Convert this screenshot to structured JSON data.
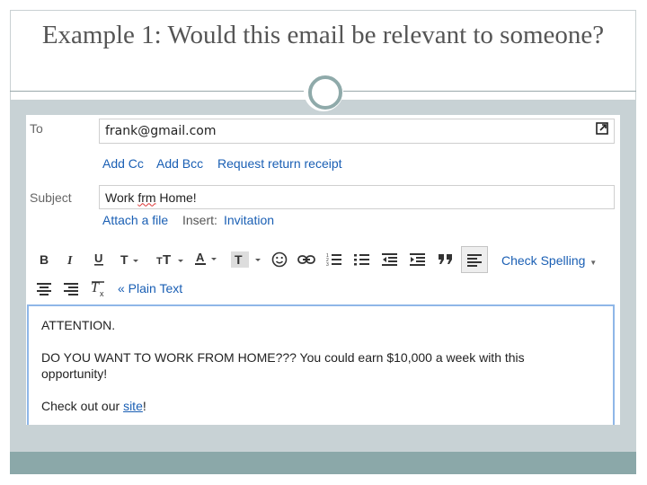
{
  "slide": {
    "title": "Example 1: Would this email be relevant to someone?"
  },
  "compose": {
    "to_label": "To",
    "to_value": "frank@gmail.com",
    "add_cc": "Add Cc",
    "add_bcc": "Add Bcc",
    "request_receipt": "Request return receipt",
    "subject_label": "Subject",
    "subject_misspelled": "frm",
    "subject_prefix": "Work ",
    "subject_suffix": " Home!",
    "attach_file": "Attach a file",
    "insert_label": "Insert:",
    "invitation": "Invitation",
    "check_spelling": "Check Spelling",
    "plain_text": "« Plain Text"
  },
  "toolbar": {
    "icons": [
      "bold-icon",
      "italic-icon",
      "underline-icon",
      "font-icon",
      "font-size-icon",
      "text-color-icon",
      "highlight-icon",
      "emoji-icon",
      "link-icon",
      "numbered-list-icon",
      "bulleted-list-icon",
      "outdent-icon",
      "indent-icon",
      "quote-icon",
      "align-left-icon",
      "align-center-icon",
      "align-right-icon",
      "remove-formatting-icon"
    ],
    "active": "align-left-icon"
  },
  "body": {
    "line1": "ATTENTION.",
    "line2": "DO YOU WANT TO WORK FROM HOME???  You could earn $10,000 a week with this",
    "line3": "opportunity!",
    "line4_prefix": "Check out our ",
    "line4_link": "site",
    "line4_suffix": "!"
  },
  "colors": {
    "link": "#1a5fb4",
    "band": "#c8d2d5",
    "footer": "#8ba8a9",
    "focus_border": "#8fb7e8"
  }
}
